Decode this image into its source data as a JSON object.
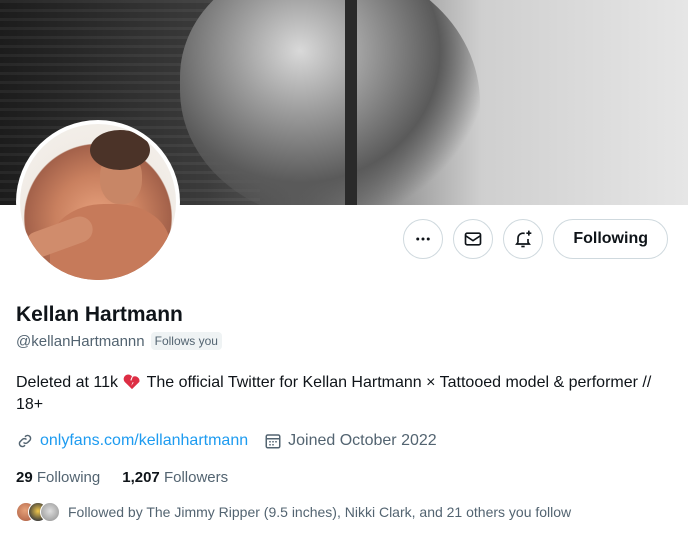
{
  "profile": {
    "name": "Kellan Hartmann",
    "handle": "@kellanHartmannn",
    "follows_you": "Follows you",
    "bio_before": "Deleted at 11k ",
    "bio_after": " The official Twitter for Kellan Hartmann × Tattooed model & performer // 18+",
    "link": "onlyfans.com/kellanhartmann",
    "joined": "Joined October 2022"
  },
  "actions": {
    "more_icon": "more-icon",
    "message_icon": "mail-icon",
    "notify_icon": "bell-plus-icon",
    "following_label": "Following"
  },
  "stats": {
    "following_count": "29",
    "following_label": "Following",
    "followers_count": "1,207",
    "followers_label": "Followers"
  },
  "followed_by": {
    "text": "Followed by The Jimmy Ripper (9.5 inches), Nikki Clark, and 21 others you follow"
  },
  "icons": {
    "heart": "broken-heart-icon",
    "link": "link-icon",
    "calendar": "calendar-icon"
  },
  "colors": {
    "link": "#1d9bf0",
    "muted": "#536471",
    "text": "#0f1419",
    "border": "#cfd9de"
  }
}
